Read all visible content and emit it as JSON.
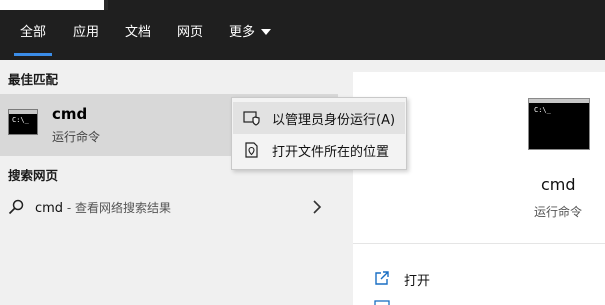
{
  "tabs": [
    {
      "label": "全部",
      "active": true
    },
    {
      "label": "应用"
    },
    {
      "label": "文档"
    },
    {
      "label": "网页"
    },
    {
      "label": "更多"
    }
  ],
  "best_match": {
    "section_title": "最佳匹配",
    "name": "cmd",
    "subtitle": "运行命令"
  },
  "web_search": {
    "section_title": "搜索网页",
    "query": "cmd",
    "suffix": " - 查看网络搜索结果"
  },
  "details": {
    "name": "cmd",
    "subtitle": "运行命令",
    "open_label": "打开"
  },
  "context_menu": {
    "items": [
      {
        "label": "以管理员身份运行(A)",
        "icon": "admin-shield-icon"
      },
      {
        "label": "打开文件所在的位置",
        "icon": "file-location-icon"
      }
    ]
  },
  "colors": {
    "accent": "#3b8de8",
    "dark_bar": "#1f1f1f",
    "selected_bg": "#d8d8d8"
  }
}
